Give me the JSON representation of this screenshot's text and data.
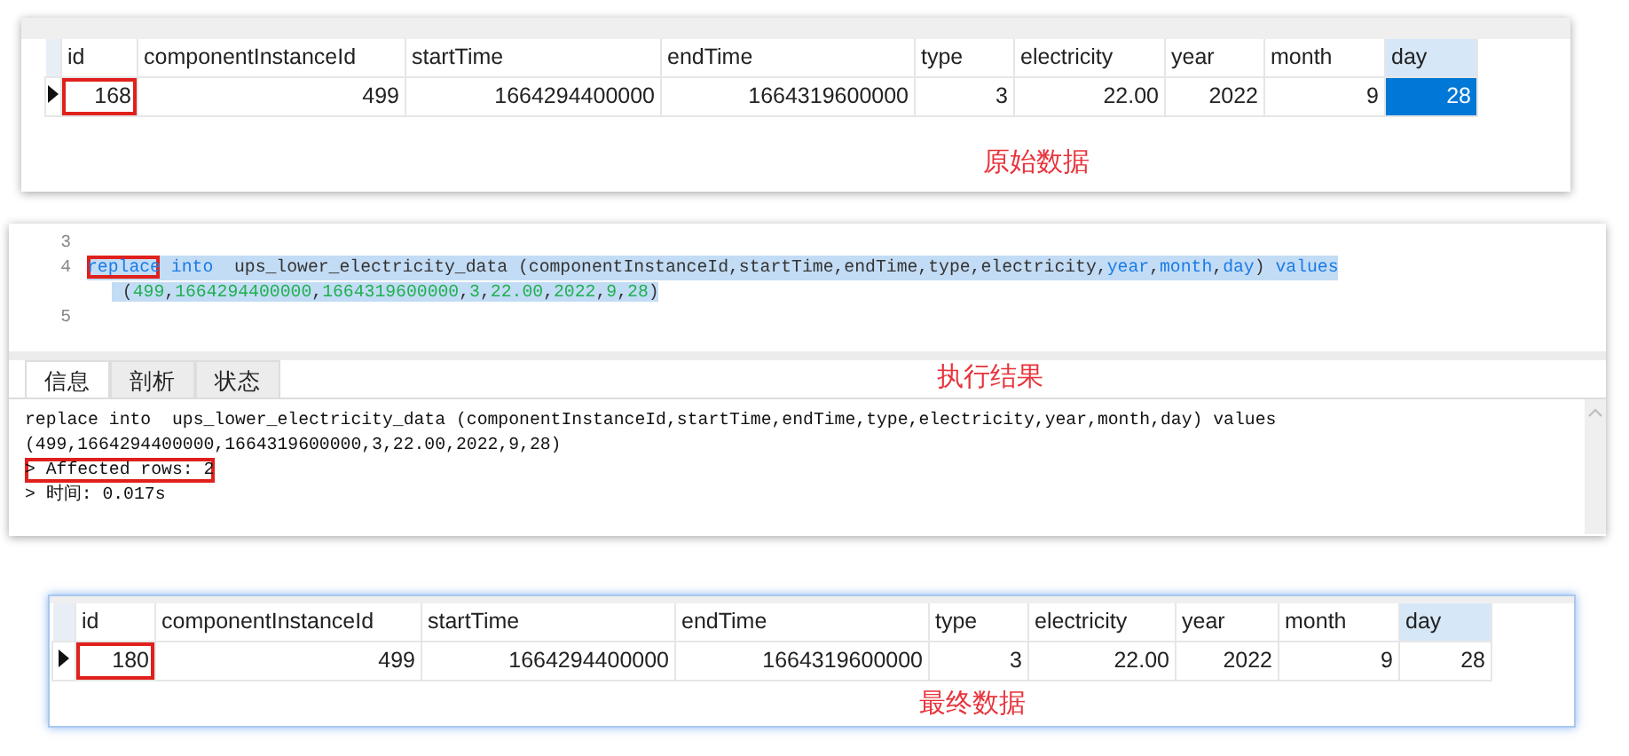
{
  "original_grid": {
    "columns": [
      {
        "label": "id",
        "selected": false
      },
      {
        "label": "componentInstanceId",
        "selected": false
      },
      {
        "label": "startTime",
        "selected": false
      },
      {
        "label": "endTime",
        "selected": false
      },
      {
        "label": "type",
        "selected": false
      },
      {
        "label": "electricity",
        "selected": false
      },
      {
        "label": "year",
        "selected": false
      },
      {
        "label": "month",
        "selected": false
      },
      {
        "label": "day",
        "selected": true
      }
    ],
    "rows": [
      {
        "current": true,
        "cells": [
          {
            "text": "168",
            "selected": false,
            "highlighted": true
          },
          {
            "text": "499",
            "selected": false,
            "highlighted": false
          },
          {
            "text": "1664294400000",
            "selected": false,
            "highlighted": false
          },
          {
            "text": "1664319600000",
            "selected": false,
            "highlighted": false
          },
          {
            "text": "3",
            "selected": false,
            "highlighted": false
          },
          {
            "text": "22.00",
            "selected": false,
            "highlighted": false
          },
          {
            "text": "2022",
            "selected": false,
            "highlighted": false
          },
          {
            "text": "9",
            "selected": false,
            "highlighted": false
          },
          {
            "text": "28",
            "selected": true,
            "highlighted": false
          }
        ]
      }
    ],
    "caption": "原始数据"
  },
  "query_panel": {
    "editor": {
      "lines": [
        {
          "number": "3",
          "selected": false
        },
        {
          "number": "4",
          "selected": true,
          "segments": [
            {
              "text": "replace",
              "kind": "keyword",
              "highlighted": true
            },
            {
              "text": " into",
              "kind": "keyword",
              "highlighted": false
            },
            {
              "text": "  ups_lower_electricity_data (componentInstanceId,startTime,endTime,type,electricity,",
              "kind": "plain",
              "highlighted": false
            },
            {
              "text": "year",
              "kind": "keyword",
              "highlighted": false
            },
            {
              "text": ",",
              "kind": "plain",
              "highlighted": false
            },
            {
              "text": "month",
              "kind": "keyword",
              "highlighted": false
            },
            {
              "text": ",",
              "kind": "plain",
              "highlighted": false
            },
            {
              "text": "day",
              "kind": "keyword",
              "highlighted": false
            },
            {
              "text": ") ",
              "kind": "plain",
              "highlighted": false
            },
            {
              "text": "values",
              "kind": "keyword",
              "highlighted": false
            }
          ],
          "continuation": [
            {
              "text": " (",
              "kind": "plain",
              "highlighted": false
            },
            {
              "text": "499",
              "kind": "number",
              "highlighted": false
            },
            {
              "text": ",",
              "kind": "plain",
              "highlighted": false
            },
            {
              "text": "1664294400000",
              "kind": "number",
              "highlighted": false
            },
            {
              "text": ",",
              "kind": "plain",
              "highlighted": false
            },
            {
              "text": "1664319600000",
              "kind": "number",
              "highlighted": false
            },
            {
              "text": ",",
              "kind": "plain",
              "highlighted": false
            },
            {
              "text": "3",
              "kind": "number",
              "highlighted": false
            },
            {
              "text": ",",
              "kind": "plain",
              "highlighted": false
            },
            {
              "text": "22.00",
              "kind": "number",
              "highlighted": false
            },
            {
              "text": ",",
              "kind": "plain",
              "highlighted": false
            },
            {
              "text": "2022",
              "kind": "number",
              "highlighted": false
            },
            {
              "text": ",",
              "kind": "plain",
              "highlighted": false
            },
            {
              "text": "9",
              "kind": "number",
              "highlighted": false
            },
            {
              "text": ",",
              "kind": "plain",
              "highlighted": false
            },
            {
              "text": "28",
              "kind": "number",
              "highlighted": false
            },
            {
              "text": ")",
              "kind": "plain",
              "highlighted": false
            }
          ]
        },
        {
          "number": "5",
          "selected": false
        }
      ]
    },
    "tabs": [
      {
        "label": "信息",
        "selected": true
      },
      {
        "label": "剖析",
        "selected": false
      },
      {
        "label": "状态",
        "selected": false
      }
    ],
    "caption": "执行结果",
    "output": [
      {
        "text": "replace into  ups_lower_electricity_data (componentInstanceId,startTime,endTime,type,electricity,year,month,day) values",
        "highlighted": false
      },
      {
        "text": "(499,1664294400000,1664319600000,3,22.00,2022,9,28)",
        "highlighted": false
      },
      {
        "text": "> Affected rows: 2",
        "highlighted": true
      },
      {
        "text": "> 时间: 0.017s",
        "highlighted": false
      }
    ]
  },
  "final_grid": {
    "columns": [
      {
        "label": "id",
        "selected": false
      },
      {
        "label": "componentInstanceId",
        "selected": false
      },
      {
        "label": "startTime",
        "selected": false
      },
      {
        "label": "endTime",
        "selected": false
      },
      {
        "label": "type",
        "selected": false
      },
      {
        "label": "electricity",
        "selected": false
      },
      {
        "label": "year",
        "selected": false
      },
      {
        "label": "month",
        "selected": false
      },
      {
        "label": "day",
        "selected": true
      }
    ],
    "rows": [
      {
        "current": true,
        "cells": [
          {
            "text": "180",
            "selected": false,
            "highlighted": true
          },
          {
            "text": "499",
            "selected": false,
            "highlighted": false
          },
          {
            "text": "1664294400000",
            "selected": false,
            "highlighted": false
          },
          {
            "text": "1664319600000",
            "selected": false,
            "highlighted": false
          },
          {
            "text": "3",
            "selected": false,
            "highlighted": false
          },
          {
            "text": "22.00",
            "selected": false,
            "highlighted": false
          },
          {
            "text": "2022",
            "selected": false,
            "highlighted": false
          },
          {
            "text": "9",
            "selected": false,
            "highlighted": false
          },
          {
            "text": "28",
            "selected": false,
            "highlighted": false
          }
        ]
      }
    ],
    "caption": "最终数据"
  }
}
